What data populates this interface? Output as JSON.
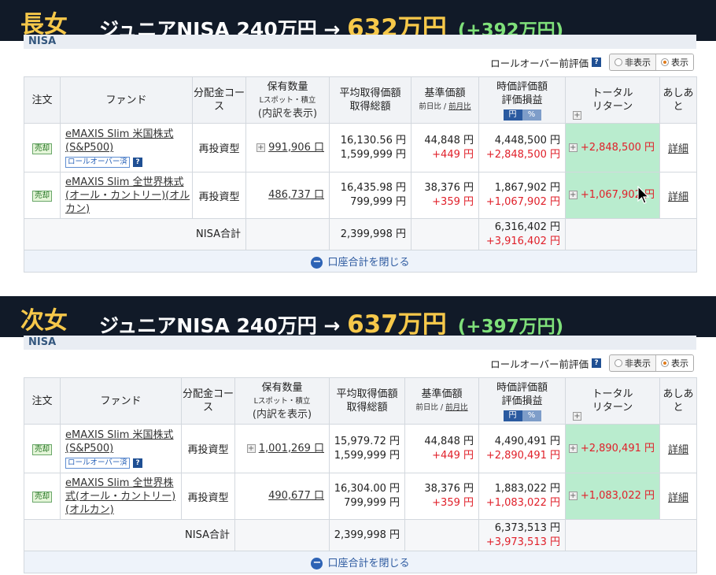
{
  "sections": [
    {
      "who": "長女",
      "headline_prefix": "ジュニアNISA 240万円 → ",
      "headline_amount": "632万円",
      "headline_diff": "(+392万円)",
      "nisa_label": "NISA",
      "rollover_label": "ロールオーバー前評価",
      "radio_hide": "非表示",
      "radio_show": "表示",
      "headers": {
        "order": "注文",
        "fund": "ファンド",
        "dist": "分配金コース",
        "qty": "保有数量",
        "qty_sub": "Lスポット・積立",
        "qty_sub2": "(内訳を表示)",
        "avg1": "平均取得価額",
        "avg2": "取得総額",
        "base1": "基準価額",
        "base_sub_a": "前日比",
        "base_sub_sep": " / ",
        "base_sub_b": "前月比",
        "val1": "時価評価額",
        "val2": "評価損益",
        "toggle_yen": "円",
        "toggle_pct": "%",
        "total_ret1": "トータル",
        "total_ret2": "リターン",
        "ashiato": "あしあと"
      },
      "rows": [
        {
          "sell": "売却",
          "fund": "eMAXIS Slim 米国株式(S&P500)",
          "badge": "ロールオーバー済",
          "dist": "再投資型",
          "qty": "991,906 口",
          "avg_price": "16,130.56 円",
          "avg_total": "1,599,999 円",
          "base": "44,848 円",
          "base_change": "+449 円",
          "market": "4,448,500 円",
          "gain": "+2,848,500 円",
          "total_return": "+2,848,500 円",
          "detail": "詳細"
        },
        {
          "sell": "売却",
          "fund": "eMAXIS Slim 全世界株式(オール・カントリー)(オルカン)",
          "badge": "",
          "dist": "再投資型",
          "qty": "486,737 口",
          "avg_price": "16,435.98 円",
          "avg_total": "799,999 円",
          "base": "38,376 円",
          "base_change": "+359 円",
          "market": "1,867,902 円",
          "gain": "+1,067,902 円",
          "total_return": "+1,067,902 円",
          "detail": "詳細"
        }
      ],
      "total_label": "NISA合計",
      "total_cost": "2,399,998 円",
      "total_market": "6,316,402 円",
      "total_gain": "+3,916,402 円",
      "close_label": "口座合計を閉じる"
    },
    {
      "who": "次女",
      "headline_prefix": "ジュニアNISA 240万円 → ",
      "headline_amount": "637万円",
      "headline_diff": "(+397万円)",
      "nisa_label": "NISA",
      "rollover_label": "ロールオーバー前評価",
      "radio_hide": "非表示",
      "radio_show": "表示",
      "headers": {
        "order": "注文",
        "fund": "ファンド",
        "dist": "分配金コース",
        "qty": "保有数量",
        "qty_sub": "Lスポット・積立",
        "qty_sub2": "(内訳を表示)",
        "avg1": "平均取得価額",
        "avg2": "取得総額",
        "base1": "基準価額",
        "base_sub_a": "前日比",
        "base_sub_sep": " / ",
        "base_sub_b": "前月比",
        "val1": "時価評価額",
        "val2": "評価損益",
        "toggle_yen": "円",
        "toggle_pct": "%",
        "total_ret1": "トータル",
        "total_ret2": "リターン",
        "ashiato": "あしあと"
      },
      "rows": [
        {
          "sell": "売却",
          "fund": "eMAXIS Slim 米国株式(S&P500)",
          "badge": "ロールオーバー済",
          "dist": "再投資型",
          "qty": "1,001,269 口",
          "avg_price": "15,979.72 円",
          "avg_total": "1,599,999 円",
          "base": "44,848 円",
          "base_change": "+449 円",
          "market": "4,490,491 円",
          "gain": "+2,890,491 円",
          "total_return": "+2,890,491 円",
          "detail": "詳細"
        },
        {
          "sell": "売却",
          "fund": "eMAXIS Slim 全世界株式(オール・カントリー)(オルカン)",
          "badge": "",
          "dist": "再投資型",
          "qty": "490,677 口",
          "avg_price": "16,304.00 円",
          "avg_total": "799,999 円",
          "base": "38,376 円",
          "base_change": "+359 円",
          "market": "1,883,022 円",
          "gain": "+1,083,022 円",
          "total_return": "+1,083,022 円",
          "detail": "詳細"
        }
      ],
      "total_label": "NISA合計",
      "total_cost": "2,399,998 円",
      "total_market": "6,373,513 円",
      "total_gain": "+3,973,513 円",
      "close_label": "口座合計を閉じる"
    }
  ],
  "colors": {
    "banner_bg": "#111a28",
    "accent_gold": "#f6c84a",
    "accent_green": "#7fe07a",
    "gain_red": "#e0202a",
    "total_return_bg": "#b9ecce"
  }
}
